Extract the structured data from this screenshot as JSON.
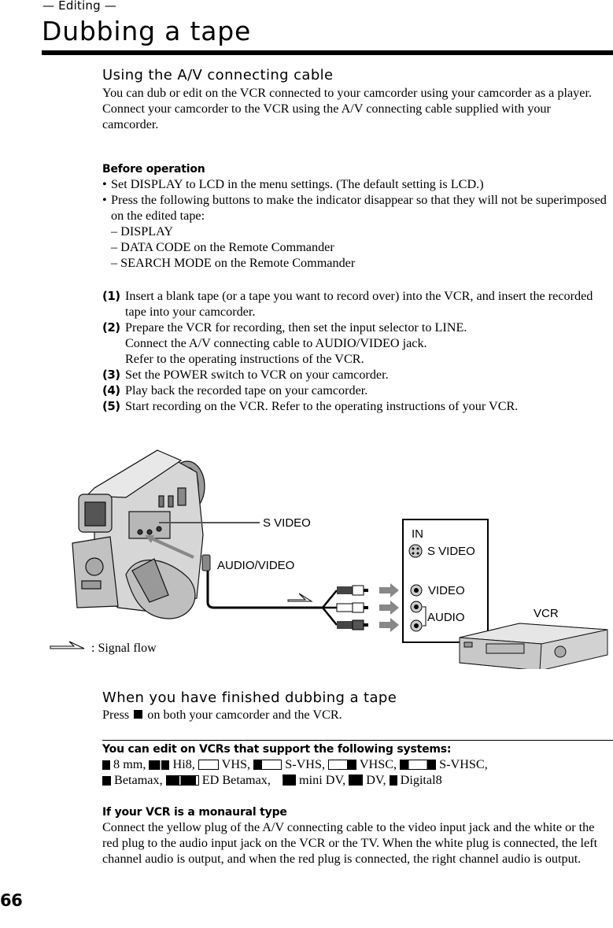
{
  "header": {
    "section_label": "— Editing —",
    "title": "Dubbing a tape"
  },
  "section_av": {
    "heading": "Using the A/V connecting cable",
    "paragraphs": [
      "You can dub or edit on the VCR connected to your camcorder using your camcorder as a player.",
      "Connect your camcorder to the VCR using the A/V connecting cable supplied with your camcorder."
    ]
  },
  "before_operation": {
    "heading": "Before operation",
    "bullets": [
      "Set DISPLAY to LCD in the menu settings. (The default setting is LCD.)",
      "Press the following buttons to make the indicator disappear so that they will not be superimposed on the edited tape:"
    ],
    "sub_items": [
      "– DISPLAY",
      "– DATA CODE on the Remote Commander",
      "– SEARCH MODE on the Remote Commander"
    ]
  },
  "steps": [
    {
      "num": "(1)",
      "lines": [
        "Insert a blank tape (or a tape you want to record over) into the VCR, and insert the recorded tape into your camcorder."
      ]
    },
    {
      "num": "(2)",
      "lines": [
        "Prepare the VCR for recording, then set the input selector to LINE.",
        "Connect the A/V connecting cable to AUDIO/VIDEO jack.",
        "Refer to the operating instructions of the VCR."
      ]
    },
    {
      "num": "(3)",
      "lines": [
        "Set the POWER switch to VCR on your camcorder."
      ]
    },
    {
      "num": "(4)",
      "lines": [
        "Play back the recorded tape on your camcorder."
      ]
    },
    {
      "num": "(5)",
      "lines": [
        "Start recording on the VCR. Refer to the operating instructions of your VCR."
      ]
    }
  ],
  "diagram": {
    "camcorder_labels": {
      "s_video": "S VIDEO",
      "audio_video": "AUDIO/VIDEO"
    },
    "vcr_panel": {
      "in_label": "IN",
      "s_video": "S VIDEO",
      "video": "VIDEO",
      "audio": "AUDIO"
    },
    "vcr_label": "VCR",
    "legend": ": Signal flow"
  },
  "finish": {
    "heading": "When you have finished dubbing a tape",
    "text_before": "Press",
    "stop_icon": "stop-icon",
    "text_after": "on both your camcorder and the VCR."
  },
  "systems": {
    "heading": "You can edit on VCRs that support the following systems:",
    "items": [
      {
        "logo": "8",
        "label": "8 mm,"
      },
      {
        "logo": "Hi8",
        "label": "Hi8,"
      },
      {
        "logo": "VHS",
        "label": "VHS,"
      },
      {
        "logo": "S-VHS",
        "label": "S-VHS,"
      },
      {
        "logo": "VHS-C",
        "label": "VHSC,"
      },
      {
        "logo": "S-VHS-C",
        "label": "S-VHSC,"
      },
      {
        "logo": "β",
        "label": "Betamax,"
      },
      {
        "logo": "ED Beta",
        "label": "ED Betamax,"
      },
      {
        "logo": "Mini DV",
        "label": "mini DV,"
      },
      {
        "logo": "DV",
        "label": "DV,"
      },
      {
        "logo": "D8",
        "label": "Digital8"
      }
    ]
  },
  "monaural": {
    "heading": "If your VCR is a monaural type",
    "text": "Connect the yellow plug of the A/V connecting cable to the video input jack and the white or the red plug to the audio input jack on the VCR or the TV. When the white plug is connected, the left channel audio is output, and when the red plug is connected, the right channel audio is output."
  },
  "footer": {
    "page_number": "66"
  }
}
